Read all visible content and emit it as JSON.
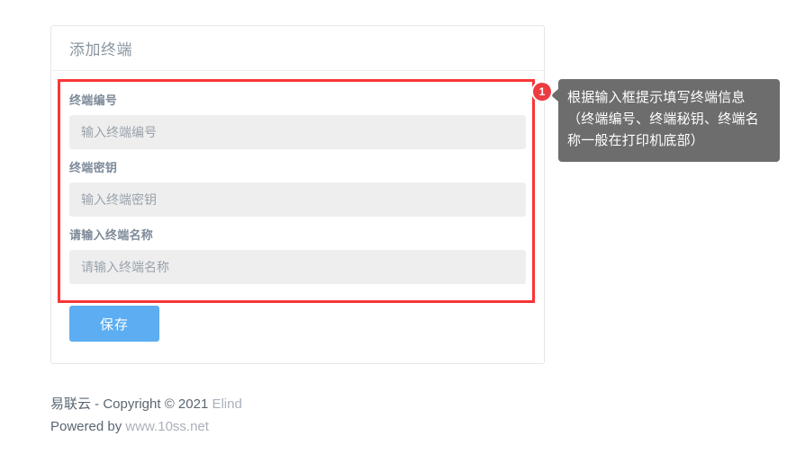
{
  "card": {
    "title": "添加终端",
    "fields": [
      {
        "label": "终端编号",
        "placeholder": "输入终端编号",
        "value": ""
      },
      {
        "label": "终端密钥",
        "placeholder": "输入终端密钥",
        "value": ""
      },
      {
        "label": "请输入终端名称",
        "placeholder": "请输入终端名称",
        "value": ""
      }
    ],
    "save_label": "保存"
  },
  "callout": {
    "badge": "1",
    "text": "根据输入框提示填写终端信息（终端编号、终端秘钥、终端名称一般在打印机底部）"
  },
  "footer": {
    "line1_prefix": "易联云 - Copyright © 2021 ",
    "line1_suffix": "Elind",
    "line2_prefix": "Powered by ",
    "line2_suffix": "www.10ss.net"
  },
  "colors": {
    "highlight": "#f93636",
    "badge": "#ec3c42",
    "tooltip_bg": "#6d6d6d",
    "primary_button": "#5cadf2",
    "input_bg": "#eeeeee"
  }
}
